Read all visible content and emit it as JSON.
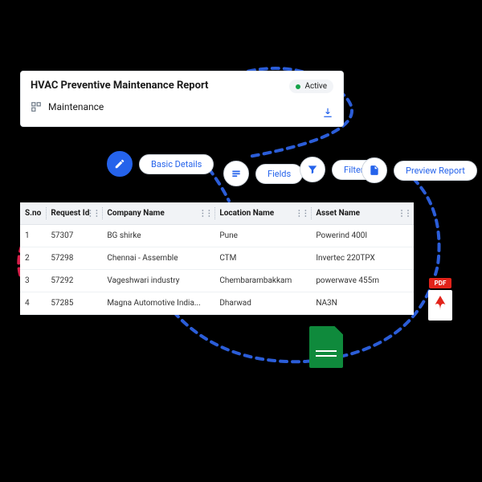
{
  "header": {
    "title": "HVAC Preventive Maintenance Report",
    "category": "Maintenance",
    "status": "Active"
  },
  "steps": {
    "basic": "Basic Details",
    "fields": "Fields",
    "filters": "Filters",
    "preview": "Preview Report"
  },
  "table": {
    "columns": {
      "sno": "S.no",
      "request_id": "Request Id",
      "company": "Company Name",
      "location": "Location Name",
      "asset": "Asset Name"
    },
    "rows": [
      {
        "sno": "1",
        "request_id": "57307",
        "company": "BG shirke",
        "location": "Pune",
        "asset": "Powerind 400I"
      },
      {
        "sno": "2",
        "request_id": "57298",
        "company": "Chennai - Assemble",
        "location": "CTM",
        "asset": "Invertec 220TPX"
      },
      {
        "sno": "3",
        "request_id": "57292",
        "company": "Vageshwari industry",
        "location": "Chembarambakkam",
        "asset": "powerwave 455m"
      },
      {
        "sno": "4",
        "request_id": "57285",
        "company": "Magna Automotive India...",
        "location": "Dharwad",
        "asset": "NA3N"
      }
    ]
  },
  "files": {
    "pdf_label": "PDF"
  }
}
